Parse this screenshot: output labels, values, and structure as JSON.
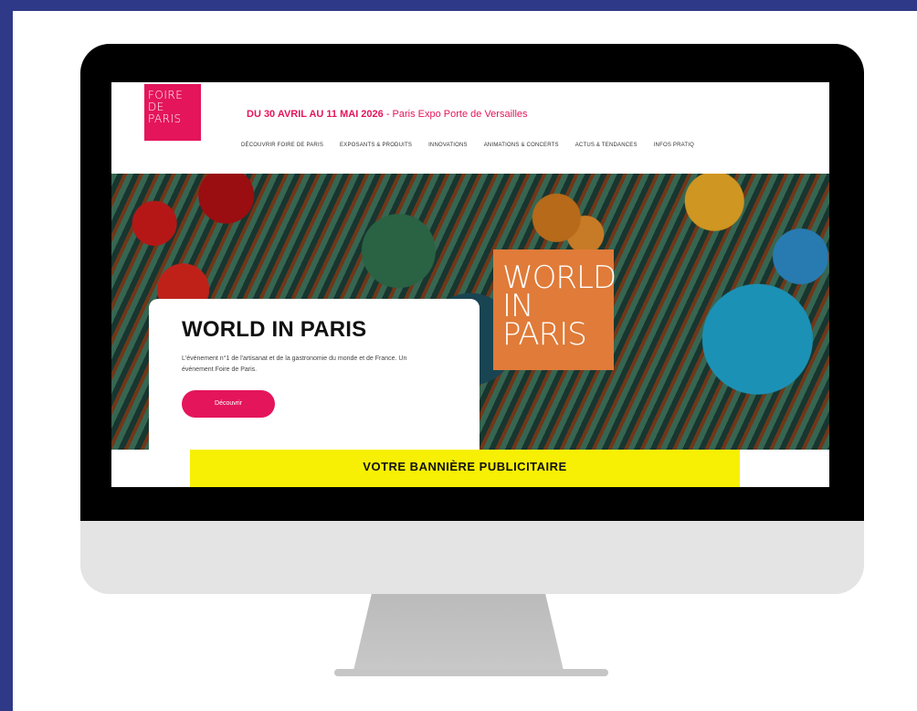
{
  "site": {
    "logo_lines": [
      "FOIRE",
      "DE",
      "PARIS"
    ],
    "dates_bold": "DU 30 AVRIL AU 11 MAI 2026",
    "dates_rest": " - Paris Expo Porte de Versailles",
    "nav": [
      "DÉCOUVRIR FOIRE DE PARIS",
      "EXPOSANTS & PRODUITS",
      "INNOVATIONS",
      "ANIMATIONS & CONCERTS",
      "ACTUS & TENDANCES",
      "INFOS PRATIQ"
    ]
  },
  "hero": {
    "badge_lines": [
      "WORLD",
      "IN",
      "PARIS"
    ],
    "card_title": "WORLD IN PARIS",
    "card_text": "L'événement n°1 de l'artisanat et de la gastronomie du monde et de France. Un événement Foire de Paris.",
    "card_button": "Découvrir"
  },
  "ad_banner": "VOTRE BANNIÈRE PUBLICITAIRE",
  "colors": {
    "frame": "#2e3a87",
    "brand_pink": "#e4155b",
    "badge_orange": "#e07b39",
    "banner_yellow": "#f7f005"
  }
}
